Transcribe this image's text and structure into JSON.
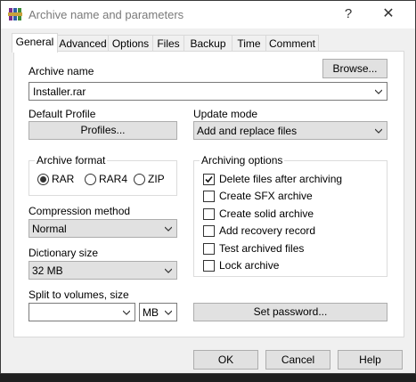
{
  "window": {
    "title": "Archive name and parameters",
    "help_glyph": "?",
    "close_glyph": "✕"
  },
  "tabs": [
    "General",
    "Advanced",
    "Options",
    "Files",
    "Backup",
    "Time",
    "Comment"
  ],
  "archive_name": {
    "label": "Archive name",
    "browse": "Browse...",
    "value": "Installer.rar"
  },
  "profile": {
    "label": "Default Profile",
    "button": "Profiles..."
  },
  "update_mode": {
    "label": "Update mode",
    "value": "Add and replace files"
  },
  "archive_format": {
    "label": "Archive format",
    "options": [
      "RAR",
      "RAR4",
      "ZIP"
    ],
    "selected": "RAR"
  },
  "compression": {
    "label": "Compression method",
    "value": "Normal"
  },
  "dictionary": {
    "label": "Dictionary size",
    "value": "32 MB"
  },
  "split": {
    "label": "Split to volumes, size",
    "value": "",
    "unit": "MB"
  },
  "archiving_options": {
    "label": "Archiving options",
    "items": [
      {
        "label": "Delete files after archiving",
        "checked": true
      },
      {
        "label": "Create SFX archive",
        "checked": false
      },
      {
        "label": "Create solid archive",
        "checked": false
      },
      {
        "label": "Add recovery record",
        "checked": false
      },
      {
        "label": "Test archived files",
        "checked": false
      },
      {
        "label": "Lock archive",
        "checked": false
      }
    ]
  },
  "password_button": "Set password...",
  "footer": {
    "ok": "OK",
    "cancel": "Cancel",
    "help": "Help"
  },
  "icons": {
    "app": "winrar-icon",
    "chevron": "chevron-down-icon"
  }
}
